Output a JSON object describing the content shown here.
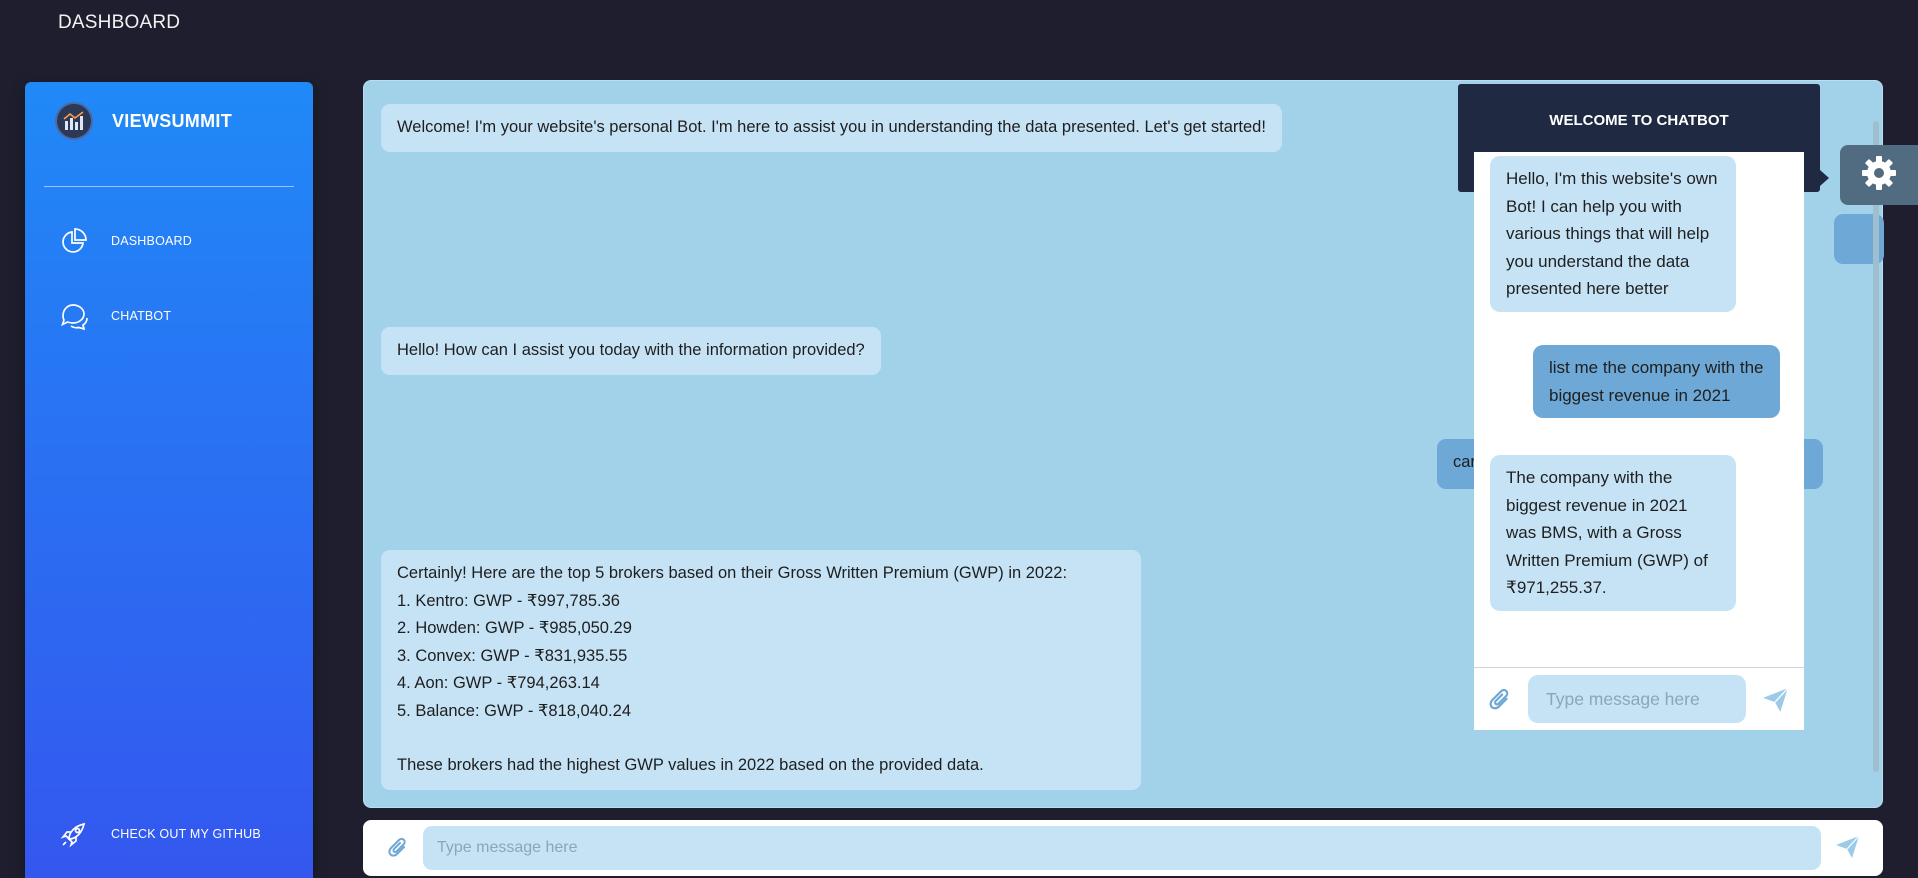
{
  "header": {
    "title": "DASHBOARD"
  },
  "sidebar": {
    "brand": "VIEWSUMMIT",
    "items": [
      {
        "label": "DASHBOARD",
        "icon": "pie-chart-icon"
      },
      {
        "label": "CHATBOT",
        "icon": "chat-bubbles-icon"
      }
    ],
    "footer": {
      "label": "CHECK OUT MY GITHUB",
      "icon": "rocket-icon"
    }
  },
  "chat": {
    "messages": [
      {
        "from": "bot",
        "text": "Welcome! I'm your website's personal Bot. I'm here to assist you in understanding the data presented. Let's get started!"
      },
      {
        "from": "bot",
        "text": "Hello! How can I assist you today with the information provided?"
      },
      {
        "from": "user",
        "text": "car"
      },
      {
        "from": "bot",
        "lines": [
          "Certainly! Here are the top 5 brokers based on their Gross Written Premium (GWP) in 2022:",
          "1. Kentro: GWP - ₹997,785.36",
          "2. Howden: GWP - ₹985,050.29",
          "3. Convex: GWP - ₹831,935.55",
          "4. Aon: GWP - ₹794,263.14",
          "5. Balance: GWP - ₹818,040.24",
          "These brokers had the highest GWP values in 2022 based on the provided data."
        ]
      }
    ],
    "input": {
      "placeholder": "Type message here"
    }
  },
  "widget": {
    "title": "WELCOME TO CHATBOT",
    "messages": [
      {
        "from": "bot",
        "text": "Hello, I'm this website's own Bot! I can help you with various things that will help you understand the data presented here better"
      },
      {
        "from": "user",
        "text": "list me the company with the biggest revenue in 2021"
      },
      {
        "from": "bot",
        "text": "The company with the biggest revenue in 2021 was BMS, with a Gross Written Premium (GWP) of ₹971,255.37."
      }
    ],
    "input": {
      "placeholder": "Type message here"
    },
    "settings_icon": "gear-icon"
  },
  "colors": {
    "background": "#1f1e2e",
    "sidebar_top": "#2089f7",
    "sidebar_bottom": "#3457ef",
    "chat_panel": "#a2d2ea",
    "bot_bubble": "#c6e3f6",
    "user_bubble": "#6da8d6",
    "widget_header": "#1f2941"
  }
}
